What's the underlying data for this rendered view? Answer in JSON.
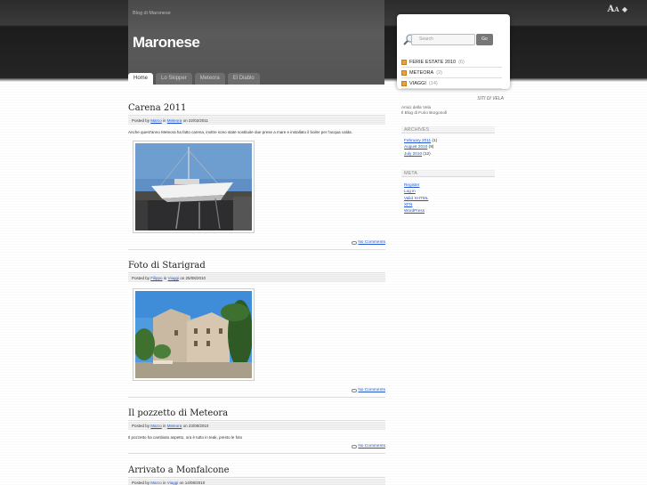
{
  "site": {
    "tagline": "Blog di Maronese",
    "title": "Maronese",
    "font_controls": {
      "big": "A",
      "small": "A",
      "arrow": "◆"
    }
  },
  "nav": {
    "tabs": [
      {
        "label": "Home",
        "active": true
      },
      {
        "label": "Lo Skipper"
      },
      {
        "label": "Meteora"
      },
      {
        "label": "El Diablo"
      }
    ]
  },
  "posts": [
    {
      "title": "Carena 2011",
      "meta_prefix": "Posted by ",
      "author": "Marco",
      "meta_in": " in ",
      "category": "Meteora",
      "meta_on": " on 22/02/2011",
      "body": "Anche quest'anno Meteora ha fatto carena, inoltre sono state sostituite due prese a mare e installato il boiler per l'acqua calda.",
      "comments_label": "No Comments"
    },
    {
      "title": "Foto di Starigrad",
      "meta_prefix": "Posted by ",
      "author": "Filippo",
      "meta_in": " in ",
      "category": "Viaggi",
      "meta_on": " on 25/08/2010",
      "comments_label": "No Comments"
    },
    {
      "title": "Il pozzetto di Meteora",
      "meta_prefix": "Posted by ",
      "author": "Marco",
      "meta_in": " in ",
      "category": "Meteora",
      "meta_on": " on 23/08/2010",
      "body": "Il pozzetto ha cambiato aspetto, ora è tutto in teak, presto le foto",
      "comments_label": "No Comments"
    },
    {
      "title": "Arrivato a Monfalcone",
      "meta_prefix": "Posted by ",
      "author": "Marco",
      "meta_in": " in ",
      "category": "Viaggi",
      "meta_on": " on 14/08/2010"
    }
  ],
  "sidebar": {
    "search_placeholder": "Search",
    "search_button": "Go",
    "categories": [
      {
        "name": "FERIE ESTATE 2010",
        "count": "(6)"
      },
      {
        "name": "METEORA",
        "count": "(2)"
      },
      {
        "name": "VIAGGI",
        "count": "(14)"
      }
    ],
    "links_heading": "SITI DI VELA",
    "links": [
      "Amici della Vela",
      "Il Blog di Furio Borgonofi"
    ],
    "archives_title": "ARCHIVES",
    "archives": [
      {
        "month": "February 2011",
        "count": " (1)"
      },
      {
        "month": "August 2010",
        "count": " (9)"
      },
      {
        "month": "July 2010",
        "count": " (12)"
      }
    ],
    "meta_title": "META",
    "meta_links": [
      "Register",
      "Log in",
      "Valid XHTML",
      "XFN",
      "WordPress"
    ]
  },
  "colors": {
    "link": "#2255cc",
    "category_icon": "#e8a33b",
    "header_bg": "#555555"
  }
}
